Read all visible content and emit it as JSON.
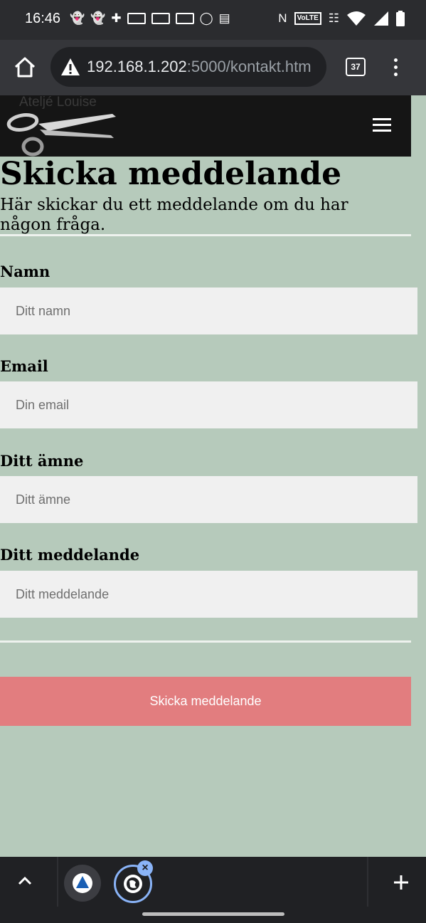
{
  "status_bar": {
    "time": "16:46",
    "icons_left": [
      "snapchat-icon",
      "snapchat-icon",
      "battery-saver-icon",
      "card-icon",
      "card-icon",
      "card-icon",
      "instagram-icon",
      "gallery-icon"
    ],
    "nfc": "N",
    "volte": "VoLTE",
    "icons_right": [
      "vibrate-icon",
      "wifi-icon",
      "signal-icon",
      "battery-icon"
    ]
  },
  "browser": {
    "url_host": "192.168.1.202",
    "url_path": ":5000/kontakt.htm",
    "tab_count": "37"
  },
  "site": {
    "logo_text": "Ateljé Louise"
  },
  "page": {
    "title": "Skicka meddelande",
    "intro": "Här skickar du ett meddelande om du har någon fråga."
  },
  "form": {
    "name_label": "Namn",
    "name_placeholder": "Ditt namn",
    "email_label": "Email",
    "email_placeholder": "Din email",
    "subject_label": "Ditt ämne",
    "subject_placeholder": "Ditt ämne",
    "message_label": "Ditt meddelande",
    "message_placeholder": "Ditt meddelande",
    "submit_label": "Skicka meddelande"
  },
  "colors": {
    "page_background": "#b6cabb",
    "header_background": "#151515",
    "submit_button": "#e27d7f",
    "input_background": "#f0f0f0"
  }
}
